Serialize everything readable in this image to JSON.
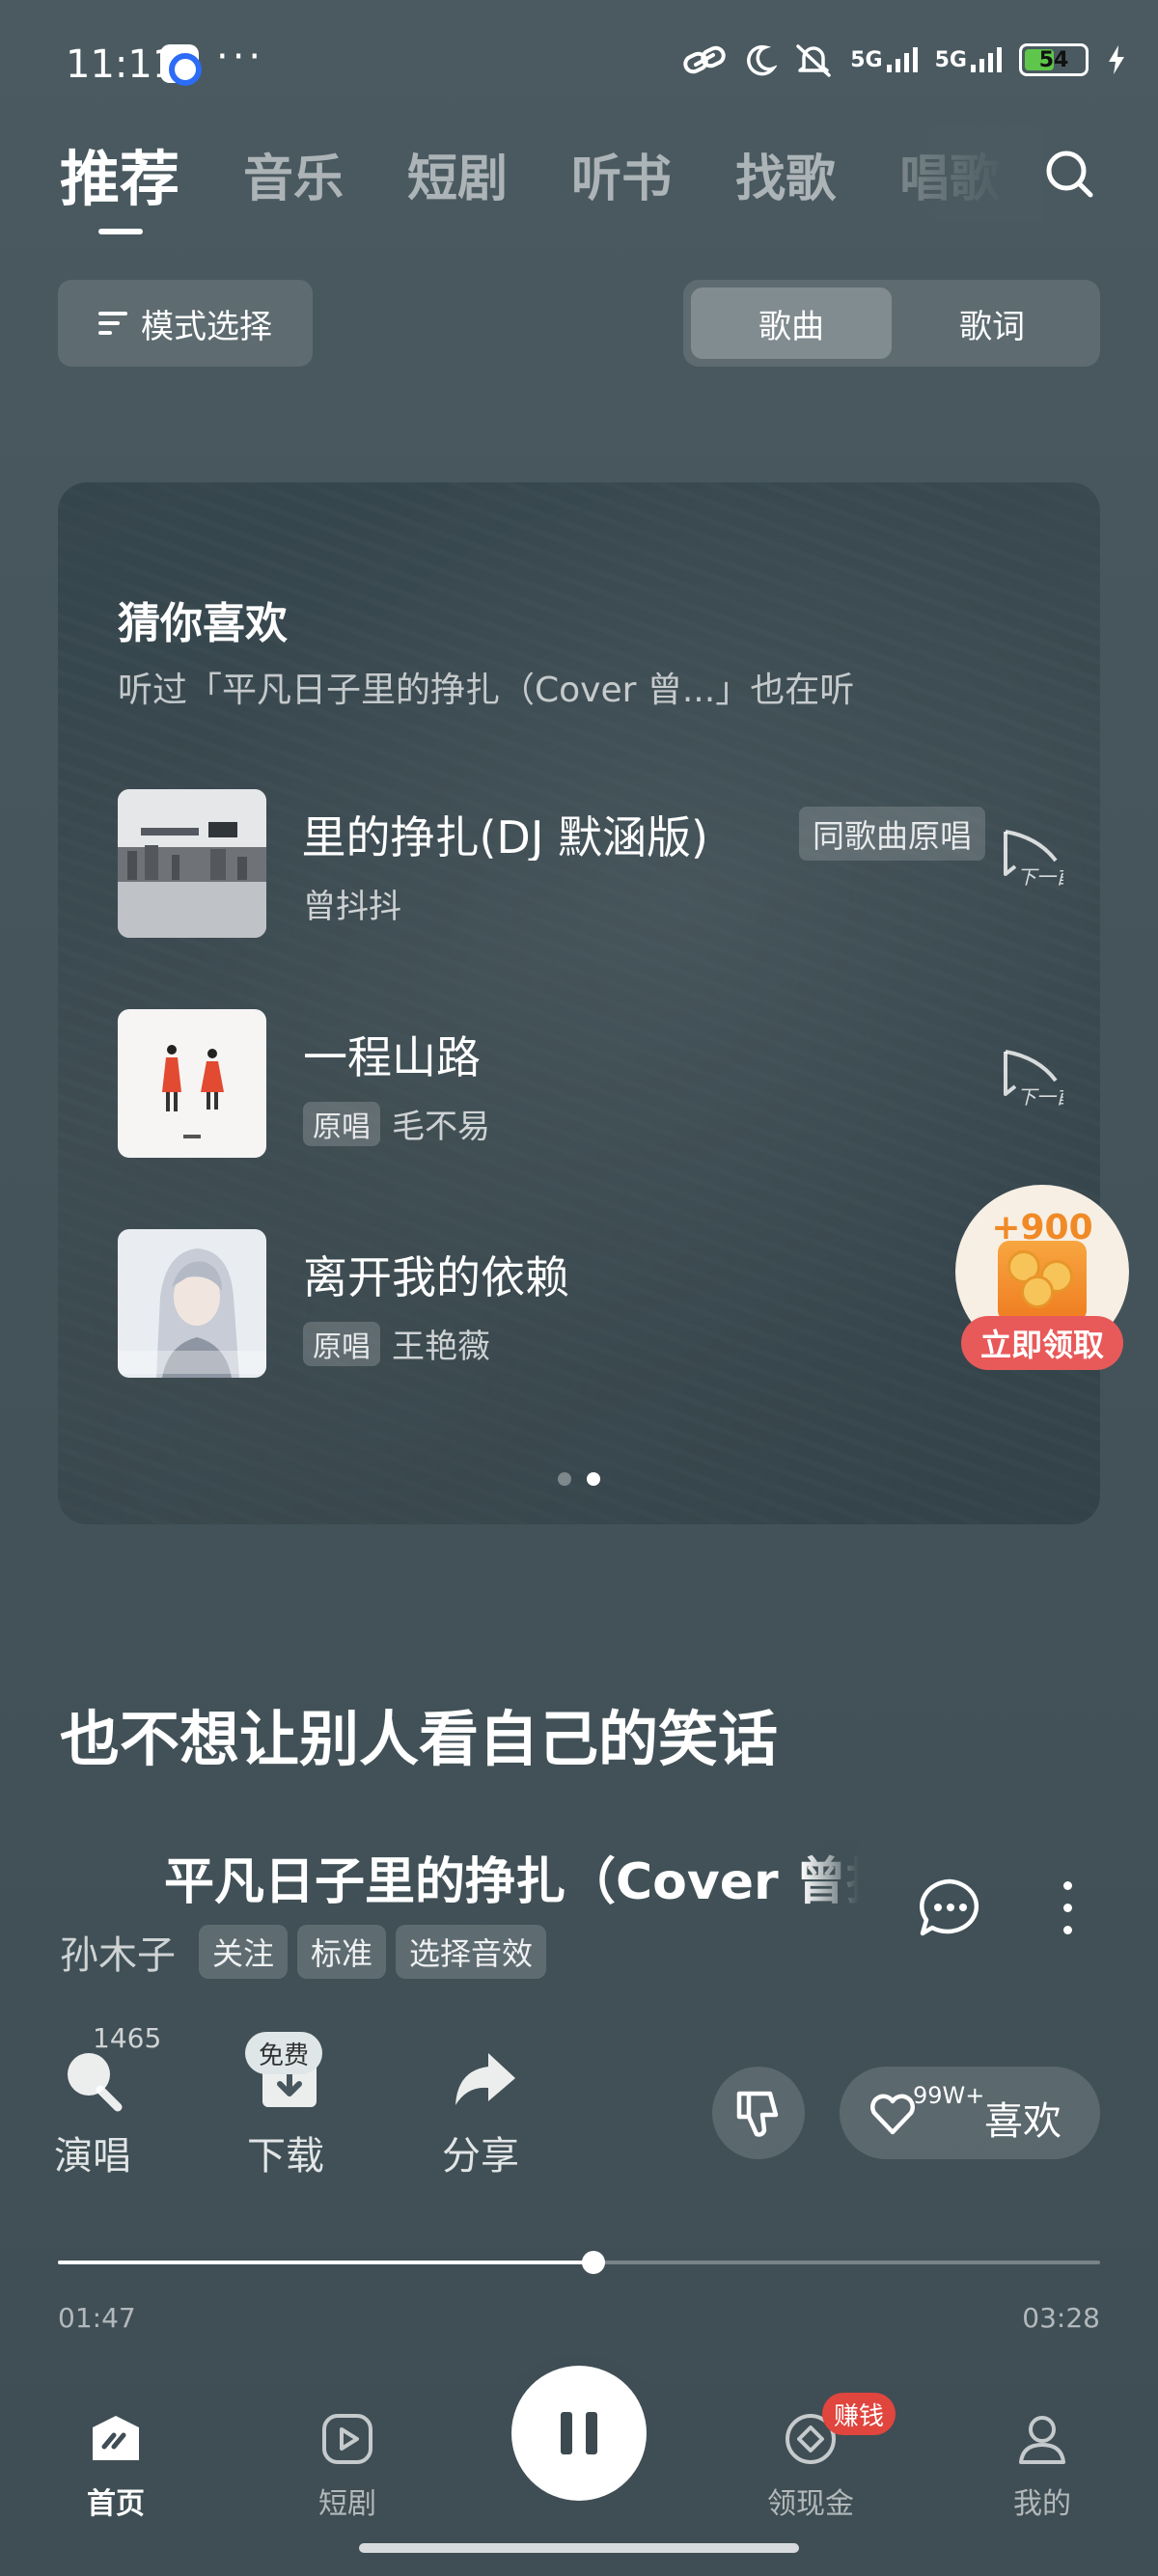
{
  "status_bar": {
    "time": "11:11",
    "more": "···",
    "network_1": "5G",
    "network_2": "5G",
    "battery": "54",
    "battery_level": 0.54
  },
  "top_tabs": [
    "推荐",
    "音乐",
    "短剧",
    "听书",
    "找歌",
    "唱歌"
  ],
  "mode_button": "模式选择",
  "segment": {
    "options": [
      "歌曲",
      "歌词"
    ],
    "selected": 0
  },
  "recommend": {
    "title": "猜你喜欢",
    "subtitle": "听过「平凡日子里的挣扎（Cover 曾...」也在听",
    "songs": [
      {
        "title": "里的挣扎(DJ 默涵版)",
        "tag": "同歌曲原唱",
        "artist": "曾抖抖",
        "badge": "",
        "next_label": "下一首"
      },
      {
        "title": "一程山路",
        "tag": "",
        "artist": "毛不易",
        "badge": "原唱",
        "next_label": "下一首"
      },
      {
        "title": "离开我的依赖",
        "tag": "",
        "artist": "王艳薇",
        "badge": "原唱"
      }
    ],
    "page_count": 2,
    "active_page": 1
  },
  "reward": {
    "amount": "+900",
    "label": "立即领取"
  },
  "lyric": "也不想让别人看自己的笑话",
  "now_playing": {
    "title": "平凡日子里的挣扎（Cover 曾抖抖）",
    "artist": "孙木子",
    "chips": [
      "关注",
      "标准",
      "选择音效"
    ]
  },
  "actions": {
    "sing": {
      "label": "演唱",
      "count": "1465"
    },
    "download": {
      "label": "下载",
      "badge": "免费"
    },
    "share": {
      "label": "分享"
    },
    "like": {
      "label": "喜欢",
      "count": "99W+"
    }
  },
  "progress": {
    "current": "01:47",
    "total": "03:28",
    "fraction": 0.514
  },
  "bottom_nav": {
    "items": [
      "首页",
      "短剧",
      "领现金",
      "我的"
    ],
    "earn_badge": "赚钱",
    "active": 0
  },
  "colors": {
    "accent_red": "#e0453e",
    "progress": "#ffffff",
    "reward_orange": "#f08a26"
  }
}
